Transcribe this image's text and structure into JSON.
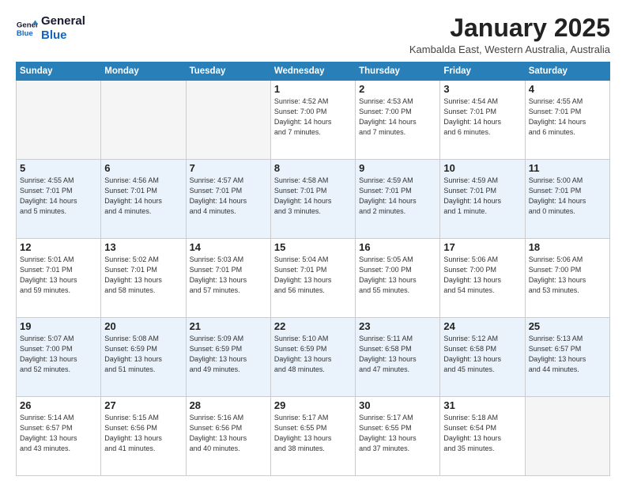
{
  "logo": {
    "line1": "General",
    "line2": "Blue"
  },
  "title": "January 2025",
  "subtitle": "Kambalda East, Western Australia, Australia",
  "days_of_week": [
    "Sunday",
    "Monday",
    "Tuesday",
    "Wednesday",
    "Thursday",
    "Friday",
    "Saturday"
  ],
  "weeks": [
    [
      {
        "day": "",
        "info": ""
      },
      {
        "day": "",
        "info": ""
      },
      {
        "day": "",
        "info": ""
      },
      {
        "day": "1",
        "info": "Sunrise: 4:52 AM\nSunset: 7:00 PM\nDaylight: 14 hours\nand 7 minutes."
      },
      {
        "day": "2",
        "info": "Sunrise: 4:53 AM\nSunset: 7:00 PM\nDaylight: 14 hours\nand 7 minutes."
      },
      {
        "day": "3",
        "info": "Sunrise: 4:54 AM\nSunset: 7:01 PM\nDaylight: 14 hours\nand 6 minutes."
      },
      {
        "day": "4",
        "info": "Sunrise: 4:55 AM\nSunset: 7:01 PM\nDaylight: 14 hours\nand 6 minutes."
      }
    ],
    [
      {
        "day": "5",
        "info": "Sunrise: 4:55 AM\nSunset: 7:01 PM\nDaylight: 14 hours\nand 5 minutes."
      },
      {
        "day": "6",
        "info": "Sunrise: 4:56 AM\nSunset: 7:01 PM\nDaylight: 14 hours\nand 4 minutes."
      },
      {
        "day": "7",
        "info": "Sunrise: 4:57 AM\nSunset: 7:01 PM\nDaylight: 14 hours\nand 4 minutes."
      },
      {
        "day": "8",
        "info": "Sunrise: 4:58 AM\nSunset: 7:01 PM\nDaylight: 14 hours\nand 3 minutes."
      },
      {
        "day": "9",
        "info": "Sunrise: 4:59 AM\nSunset: 7:01 PM\nDaylight: 14 hours\nand 2 minutes."
      },
      {
        "day": "10",
        "info": "Sunrise: 4:59 AM\nSunset: 7:01 PM\nDaylight: 14 hours\nand 1 minute."
      },
      {
        "day": "11",
        "info": "Sunrise: 5:00 AM\nSunset: 7:01 PM\nDaylight: 14 hours\nand 0 minutes."
      }
    ],
    [
      {
        "day": "12",
        "info": "Sunrise: 5:01 AM\nSunset: 7:01 PM\nDaylight: 13 hours\nand 59 minutes."
      },
      {
        "day": "13",
        "info": "Sunrise: 5:02 AM\nSunset: 7:01 PM\nDaylight: 13 hours\nand 58 minutes."
      },
      {
        "day": "14",
        "info": "Sunrise: 5:03 AM\nSunset: 7:01 PM\nDaylight: 13 hours\nand 57 minutes."
      },
      {
        "day": "15",
        "info": "Sunrise: 5:04 AM\nSunset: 7:01 PM\nDaylight: 13 hours\nand 56 minutes."
      },
      {
        "day": "16",
        "info": "Sunrise: 5:05 AM\nSunset: 7:00 PM\nDaylight: 13 hours\nand 55 minutes."
      },
      {
        "day": "17",
        "info": "Sunrise: 5:06 AM\nSunset: 7:00 PM\nDaylight: 13 hours\nand 54 minutes."
      },
      {
        "day": "18",
        "info": "Sunrise: 5:06 AM\nSunset: 7:00 PM\nDaylight: 13 hours\nand 53 minutes."
      }
    ],
    [
      {
        "day": "19",
        "info": "Sunrise: 5:07 AM\nSunset: 7:00 PM\nDaylight: 13 hours\nand 52 minutes."
      },
      {
        "day": "20",
        "info": "Sunrise: 5:08 AM\nSunset: 6:59 PM\nDaylight: 13 hours\nand 51 minutes."
      },
      {
        "day": "21",
        "info": "Sunrise: 5:09 AM\nSunset: 6:59 PM\nDaylight: 13 hours\nand 49 minutes."
      },
      {
        "day": "22",
        "info": "Sunrise: 5:10 AM\nSunset: 6:59 PM\nDaylight: 13 hours\nand 48 minutes."
      },
      {
        "day": "23",
        "info": "Sunrise: 5:11 AM\nSunset: 6:58 PM\nDaylight: 13 hours\nand 47 minutes."
      },
      {
        "day": "24",
        "info": "Sunrise: 5:12 AM\nSunset: 6:58 PM\nDaylight: 13 hours\nand 45 minutes."
      },
      {
        "day": "25",
        "info": "Sunrise: 5:13 AM\nSunset: 6:57 PM\nDaylight: 13 hours\nand 44 minutes."
      }
    ],
    [
      {
        "day": "26",
        "info": "Sunrise: 5:14 AM\nSunset: 6:57 PM\nDaylight: 13 hours\nand 43 minutes."
      },
      {
        "day": "27",
        "info": "Sunrise: 5:15 AM\nSunset: 6:56 PM\nDaylight: 13 hours\nand 41 minutes."
      },
      {
        "day": "28",
        "info": "Sunrise: 5:16 AM\nSunset: 6:56 PM\nDaylight: 13 hours\nand 40 minutes."
      },
      {
        "day": "29",
        "info": "Sunrise: 5:17 AM\nSunset: 6:55 PM\nDaylight: 13 hours\nand 38 minutes."
      },
      {
        "day": "30",
        "info": "Sunrise: 5:17 AM\nSunset: 6:55 PM\nDaylight: 13 hours\nand 37 minutes."
      },
      {
        "day": "31",
        "info": "Sunrise: 5:18 AM\nSunset: 6:54 PM\nDaylight: 13 hours\nand 35 minutes."
      },
      {
        "day": "",
        "info": ""
      }
    ]
  ]
}
